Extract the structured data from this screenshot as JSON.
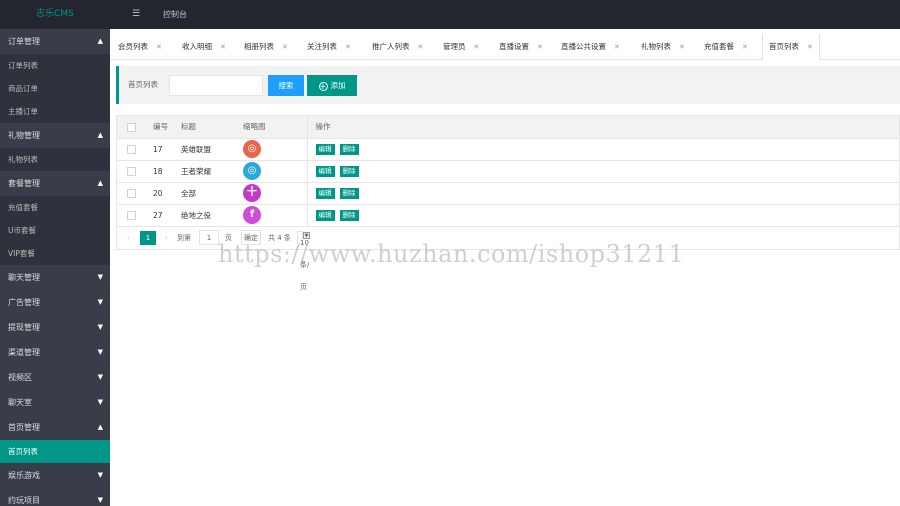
{
  "app": {
    "logo": "志乐CMS",
    "top_link": "控制台",
    "menu_icon": "hamburger-icon"
  },
  "sidebar": {
    "groups": [
      {
        "label": "订单管理",
        "expanded": true,
        "items": [
          "订单列表",
          "商品订单",
          "主播订单"
        ]
      },
      {
        "label": "礼物管理",
        "expanded": true,
        "items": [
          "礼物列表"
        ]
      },
      {
        "label": "套餐管理",
        "expanded": true,
        "items": [
          "充值套餐",
          "U币套餐",
          "VIP套餐"
        ]
      },
      {
        "label": "聊天管理",
        "expanded": false,
        "items": []
      },
      {
        "label": "广告管理",
        "expanded": false,
        "items": []
      },
      {
        "label": "提现管理",
        "expanded": false,
        "items": []
      },
      {
        "label": "渠道管理",
        "expanded": false,
        "items": []
      },
      {
        "label": "视频区",
        "expanded": false,
        "items": []
      },
      {
        "label": "聊天室",
        "expanded": false,
        "items": []
      },
      {
        "label": "首页管理",
        "expanded": true,
        "items": [
          "首页列表"
        ]
      },
      {
        "label": "娱乐游戏",
        "expanded": false,
        "items": []
      },
      {
        "label": "约玩项目",
        "expanded": false,
        "items": []
      }
    ],
    "active_item": "首页列表"
  },
  "tabs": [
    {
      "label": "会员列表"
    },
    {
      "label": "收入明细"
    },
    {
      "label": "相册列表"
    },
    {
      "label": "关注列表"
    },
    {
      "label": "推广人列表"
    },
    {
      "label": "管理员"
    },
    {
      "label": "直播设置"
    },
    {
      "label": "直播公共设置"
    },
    {
      "label": "礼物列表"
    },
    {
      "label": "充值套餐"
    },
    {
      "label": "首页列表",
      "active": true
    }
  ],
  "search": {
    "label": "首页列表",
    "value": "",
    "placeholder": "",
    "search_btn": "搜索",
    "add_btn": "添加"
  },
  "table": {
    "headers": {
      "id": "编号",
      "title": "标题",
      "thumb": "缩略图",
      "ops": "操作"
    },
    "rows": [
      {
        "id": "17",
        "title": "英雄联盟",
        "thumb_color": "#e8674a",
        "thumb_glyph": "◎"
      },
      {
        "id": "18",
        "title": "王者荣耀",
        "thumb_color": "#2aa8d8",
        "thumb_glyph": "◎"
      },
      {
        "id": "20",
        "title": "全部",
        "thumb_color": "#c43bc8",
        "thumb_glyph": "十"
      },
      {
        "id": "27",
        "title": "绝地之役",
        "thumb_color": "#d24ad9",
        "thumb_glyph": "f"
      }
    ],
    "row_actions": {
      "edit": "编辑",
      "delete": "删除"
    }
  },
  "pager": {
    "prev": "‹",
    "current": "1",
    "next": "›",
    "goto_label": "到第",
    "page_input": "1",
    "page_unit": "页",
    "confirm": "确定",
    "total": "共 4 条",
    "page_size": "10 条/页"
  },
  "watermark": "https://www.huzhan.com/ishop31211",
  "colors": {
    "accent": "#009688",
    "blue": "#1e9fff",
    "sidebar_bg": "#393d49",
    "topbar_bg": "#23262e"
  }
}
